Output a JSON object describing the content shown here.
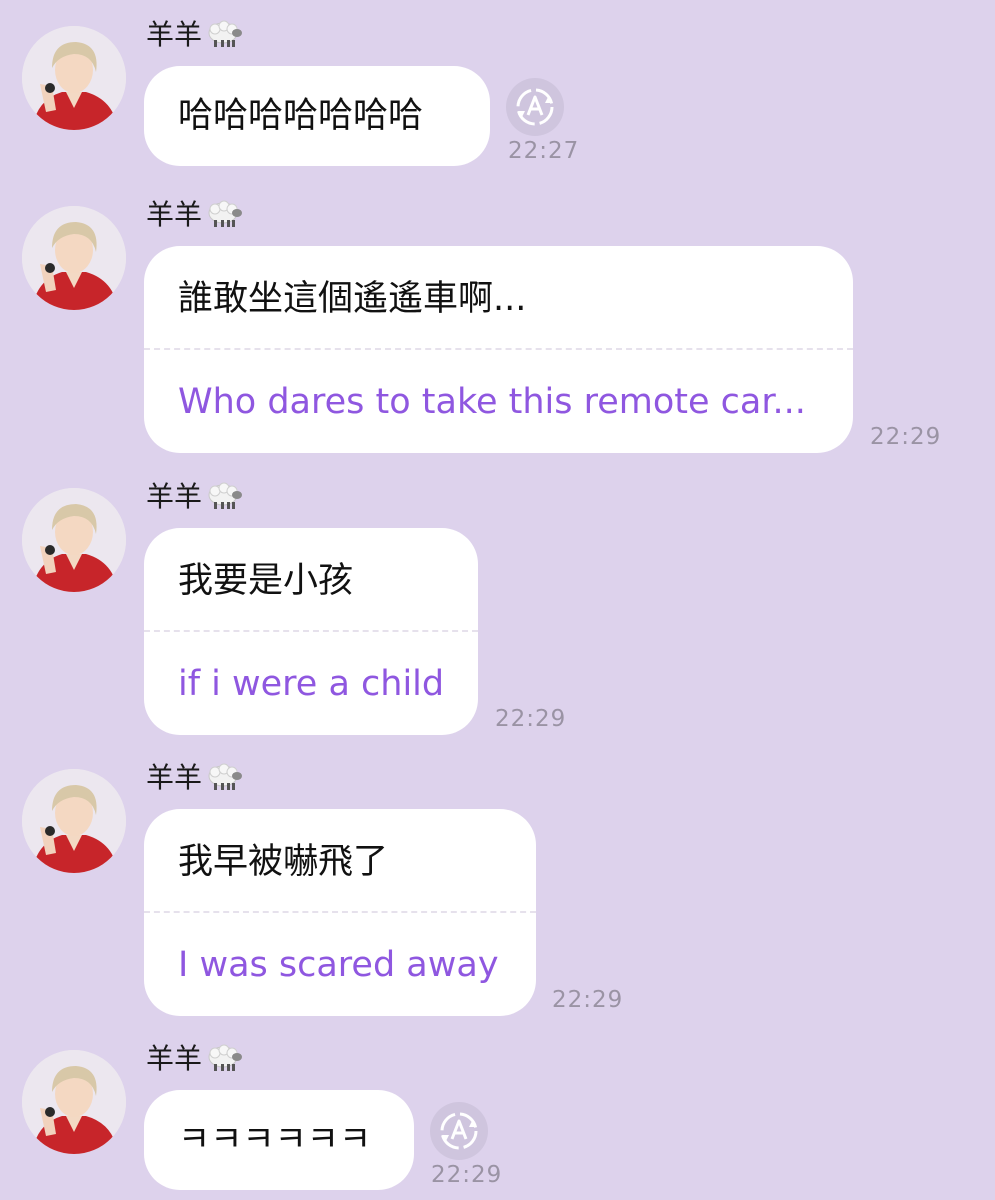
{
  "sender_name": "羊羊",
  "messages": [
    {
      "original": "哈哈哈哈哈哈哈",
      "translation": null,
      "time": "22:27",
      "show_translate_button": true
    },
    {
      "original": "誰敢坐這個遙遙車啊...",
      "translation": "Who dares to take this remote car...",
      "time": "22:29",
      "show_translate_button": false
    },
    {
      "original": "我要是小孩",
      "translation": "if i were a child",
      "time": "22:29",
      "show_translate_button": false
    },
    {
      "original": "我早被嚇飛了",
      "translation": "I was scared away",
      "time": "22:29",
      "show_translate_button": false
    },
    {
      "original": "ㅋㅋㅋㅋㅋㅋ",
      "translation": null,
      "time": "22:29",
      "show_translate_button": true
    }
  ],
  "icons": {
    "sender_badge": "sheep-icon",
    "translate_button": "translate-icon"
  },
  "colors": {
    "background": "#ddd2ec",
    "bubble": "#ffffff",
    "translation_text": "#8f57e0",
    "timestamp": "#9a93a4"
  }
}
